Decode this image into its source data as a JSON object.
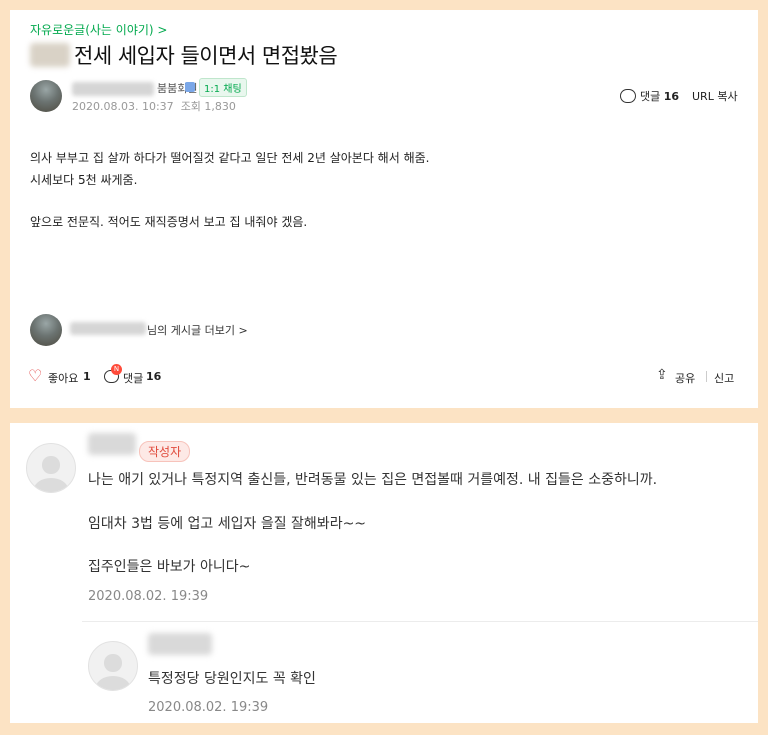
{
  "post": {
    "category": "자유로운글(사는 이야기) >",
    "title": "전세 세입자 들이면서 면접봤음",
    "author_level": "붐붐회원",
    "chat_badge": "1:1 채팅",
    "date": "2020.08.03. 10:37",
    "views": "조회 1,830",
    "comments_label": "댓글",
    "comments_count": "16",
    "url_copy": "URL 복사",
    "body": [
      "의사 부부고 집 살까 하다가 떨어질것 같다고 일단 전세 2년 살아본다 해서 해줌.",
      "시세보다 5천 싸게줌.",
      "앞으로 전문직. 적어도 재직증명서 보고 집 내줘야 겠음."
    ],
    "more_posts": "님의 게시글 더보기 >",
    "like_label": "좋아요",
    "like_count": "1",
    "new_badge": "N",
    "share_label": "공유",
    "report_label": "신고"
  },
  "comments": [
    {
      "tag": "작성자",
      "lines": [
        "나는 애기 있거나 특정지역 출신들, 반려동물 있는 집은 면접볼때 거를예정. 내 집들은 소중하니까.",
        "임대차 3법 등에 업고 세입자 을질 잘해봐라~~",
        "집주인들은 바보가 아니다~"
      ],
      "date": "2020.08.02. 19:39"
    },
    {
      "lines": [
        "특정정당 당원인지도 꼭 확인"
      ],
      "date": "2020.08.02. 19:39"
    }
  ],
  "colors": {
    "background": "#fce3c4",
    "green": "#03a94e",
    "red": "#e04a3c"
  }
}
